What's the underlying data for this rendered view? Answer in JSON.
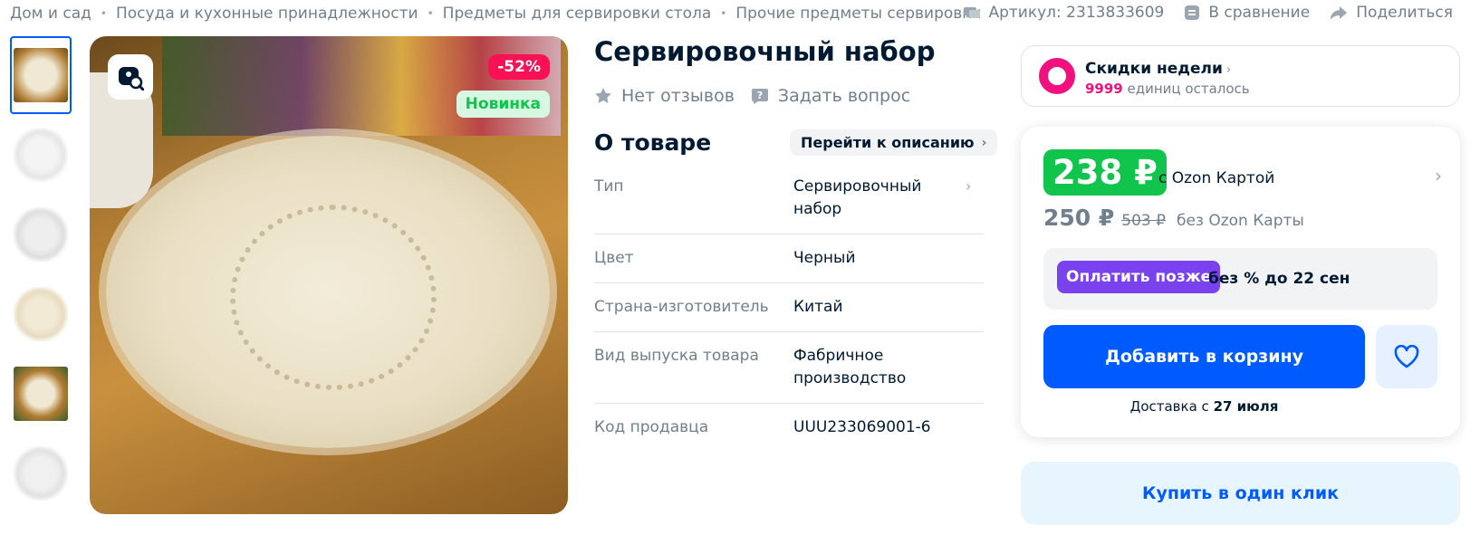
{
  "breadcrumbs": [
    "Дом и сад",
    "Посуда и кухонные принадлежности",
    "Предметы для сервировки стола",
    "Прочие предметы сервировки"
  ],
  "meta": {
    "article": "Артикул: 2313833609",
    "compare": "В сравнение",
    "share": "Поделиться"
  },
  "gallery": {
    "thumbnails": [
      "doily-1",
      "doily-2",
      "doily-3",
      "doily-4",
      "doily-5",
      "doily-6"
    ],
    "badge_discount": "-52%",
    "badge_new": "Новинка"
  },
  "product": {
    "title": "Сервировочный набор",
    "reviews": "Нет отзывов",
    "ask": "Задать вопрос",
    "about_heading": "О товаре",
    "goto_description": "Перейти к описанию",
    "specs": [
      {
        "key": "Тип",
        "value": "Сервировочный набор"
      },
      {
        "key": "Цвет",
        "value": "Черный"
      },
      {
        "key": "Страна-изготовитель",
        "value": "Китай"
      },
      {
        "key": "Вид выпуска товара",
        "value": "Фабричное производство"
      },
      {
        "key": "Код продавца",
        "value": "UUU233069001-6"
      }
    ]
  },
  "promo": {
    "title": "Скидки недели",
    "count": "9999",
    "suffix": "единиц осталось"
  },
  "pricing": {
    "card_price": "238 ₽",
    "card_note": "с Ozon Картой",
    "price": "250 ₽",
    "old_price": "503 ₽",
    "no_card_note": "без Ozon Карты",
    "pay_later_button": "Оплатить позже",
    "pay_later_text": "без % до 22 сен",
    "add_to_cart": "Добавить в корзину",
    "delivery_prefix": "Доставка с",
    "delivery_date": "27 июля",
    "one_click": "Купить в один клик"
  },
  "colors": {
    "brand_blue": "#005bff",
    "green": "#10c44c",
    "discount_pink": "#f91155",
    "purple": "#7a41ef"
  }
}
